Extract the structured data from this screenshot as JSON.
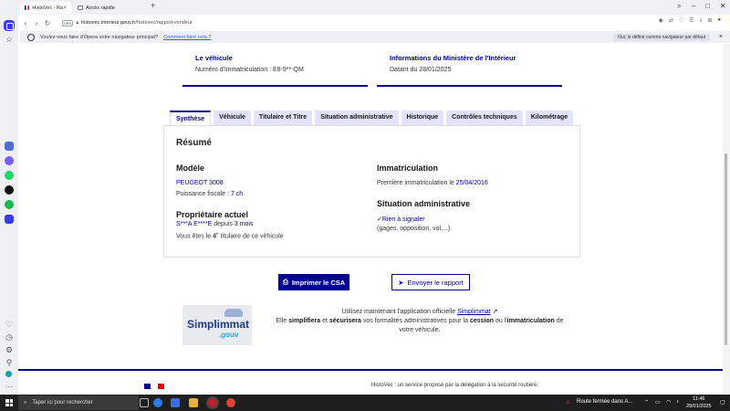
{
  "browser": {
    "tabs": [
      {
        "label": "HistoVec - Rapport vendeur",
        "active": true
      },
      {
        "label": "Accès rapide",
        "active": false
      }
    ],
    "address": {
      "badge": "VPN",
      "host": "histovec.interieur.gouv.fr",
      "path": "/histovec/rapport-vendeur"
    },
    "infobar": {
      "message": "Voulez-vous faire d'Opera votre navigateur principal?",
      "link": "Comment faire cela ?",
      "button": "Oui, le définir comme navigateur par défaut"
    }
  },
  "cards": {
    "vehicle": {
      "title": "Le véhicule",
      "text": "Numéro d'immatriculation : E8-9**-QM"
    },
    "ministry": {
      "title": "Informations du Ministère de l'Intérieur",
      "text": "Datant du 28/01/2025"
    }
  },
  "tabs": [
    "Synthèse",
    "Véhicule",
    "Titulaire et Titre",
    "Situation administrative",
    "Historique",
    "Contrôles techniques",
    "Kilométrage"
  ],
  "summary": {
    "title": "Résumé",
    "model_heading": "Modèle",
    "model_value": "PEUGEOT 3008",
    "power_label": "Puissance fiscale :",
    "power_value": "7 ch",
    "owner_heading": "Propriétaire actuel",
    "owner_name": "S***A E****E",
    "owner_since_word": "depuis",
    "owner_since_value": "3 mois",
    "owner_rank_prefix": "Vous êtes le",
    "owner_rank": "4",
    "owner_rank_suffix_sup": "e",
    "owner_rank_rest": "titulaire de ce véhicule",
    "immat_heading": "Immatriculation",
    "immat_label": "Première immatriculation le",
    "immat_date": "25/04/2016",
    "admin_heading": "Situation administrative",
    "admin_status": "Rien à signaler",
    "admin_detail": "(gages, opposition, vol,...)"
  },
  "actions": {
    "print": "Imprimer le CSA",
    "send": "Envoyer le rapport"
  },
  "simplimmat": {
    "logo_word": "Simplimmat",
    "logo_suffix": ".gouv",
    "line1_prefix": "Utilisez maintenant l'application officielle",
    "line1_link": "Simplimmat",
    "line2_a": "Elle",
    "line2_b": "simplifiera",
    "line2_c": "et",
    "line2_d": "sécurisera",
    "line2_e": "vos formalités administratives pour la",
    "line2_f": "cession",
    "line2_g": "ou l'",
    "line2_h": "immatriculation",
    "line2_i": "de",
    "line3": "votre véhicule."
  },
  "footer": {
    "text": "HistoVec : un service proposé par la délégation à la sécurité routière."
  },
  "taskbar": {
    "search_placeholder": "Taper ici pour rechercher",
    "weather": "Route fermée dans A...",
    "time": "11:46",
    "date": "29/01/2025"
  },
  "colors": {
    "brand_blue": "#000091",
    "tab_bg": "#e3e3fd",
    "opera_red": "#e0202a",
    "opera_accent": "#3b3ee8"
  }
}
